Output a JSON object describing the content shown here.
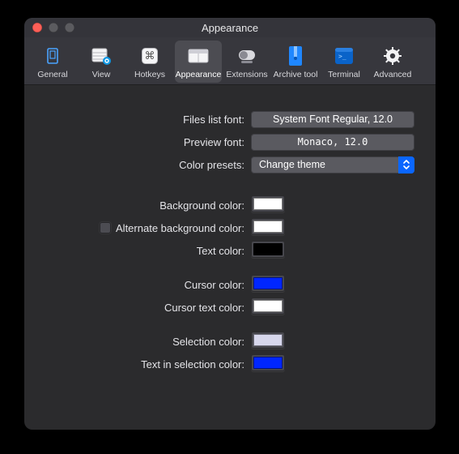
{
  "window": {
    "title": "Appearance"
  },
  "toolbar": {
    "items": [
      {
        "label": "General",
        "selected": false
      },
      {
        "label": "View",
        "selected": false
      },
      {
        "label": "Hotkeys",
        "selected": false
      },
      {
        "label": "Appearance",
        "selected": true
      },
      {
        "label": "Extensions",
        "selected": false
      },
      {
        "label": "Archive tool",
        "selected": false
      },
      {
        "label": "Terminal",
        "selected": false
      },
      {
        "label": "Advanced",
        "selected": false
      }
    ]
  },
  "form": {
    "files_list_font": {
      "label": "Files list font:",
      "value": "System Font Regular, 12.0"
    },
    "preview_font": {
      "label": "Preview font:",
      "value": "Monaco, 12.0"
    },
    "color_presets": {
      "label": "Color presets:",
      "value": "Change theme"
    },
    "background": {
      "label": "Background color:",
      "color": "#ffffff"
    },
    "alt_background": {
      "label": "Alternate background color:",
      "checked": false,
      "color": "#ffffff"
    },
    "text": {
      "label": "Text color:",
      "color": "#000000"
    },
    "cursor": {
      "label": "Cursor color:",
      "color": "#0026ff"
    },
    "cursor_text": {
      "label": "Cursor text color:",
      "color": "#ffffff"
    },
    "selection": {
      "label": "Selection color:",
      "color": "#d7d7ec"
    },
    "text_in_selection": {
      "label": "Text in selection color:",
      "color": "#0026ff"
    }
  }
}
